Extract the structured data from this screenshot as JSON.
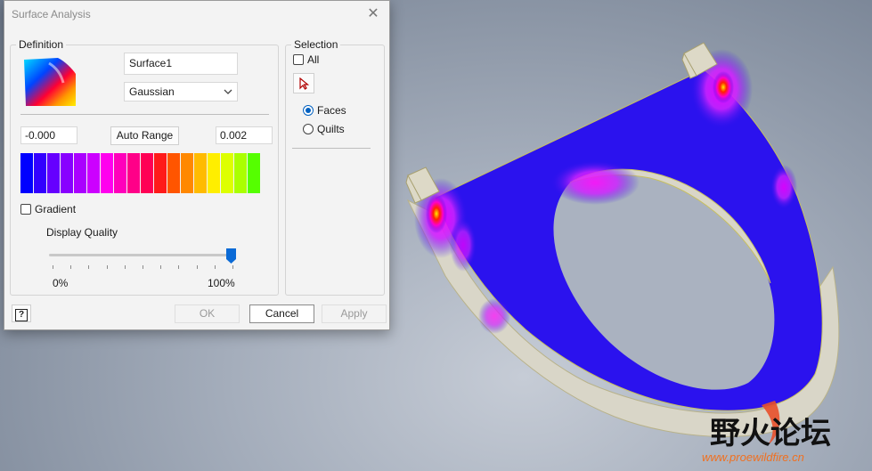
{
  "dialog": {
    "title": "Surface Analysis",
    "close_glyph": "✕",
    "definition": {
      "legend": "Definition",
      "surface_name": "Surface1",
      "analysis_type": "Gaussian",
      "min_value": "-0.000",
      "max_value": "0.002",
      "auto_range_label": "Auto Range",
      "gradient_label": "Gradient",
      "gradient_checked": false,
      "display_quality_label": "Display Quality",
      "quality_min_label": "0%",
      "quality_max_label": "100%",
      "quality_fraction": 1.0,
      "color_scale": [
        "#0000ff",
        "#3300ff",
        "#6600ff",
        "#8800ff",
        "#aa00ff",
        "#cc00ff",
        "#ff00ee",
        "#ff00bb",
        "#ff0088",
        "#ff0055",
        "#ff1a1a",
        "#ff5500",
        "#ff8800",
        "#ffbb00",
        "#ffee00",
        "#ddff00",
        "#aaff00",
        "#55ff00"
      ]
    },
    "selection": {
      "legend": "Selection",
      "all_label": "All",
      "all_checked": false,
      "faces_label": "Faces",
      "quilts_label": "Quilts",
      "selected_mode": "Faces"
    },
    "footer": {
      "ok_label": "OK",
      "cancel_label": "Cancel",
      "apply_label": "Apply",
      "help_glyph": "?"
    }
  },
  "watermark": {
    "brand": "野火论坛",
    "url": "www.proewildfire.cn"
  },
  "colors": {
    "model_face": "#2b12ee",
    "model_edge": "#d9d6c8"
  }
}
